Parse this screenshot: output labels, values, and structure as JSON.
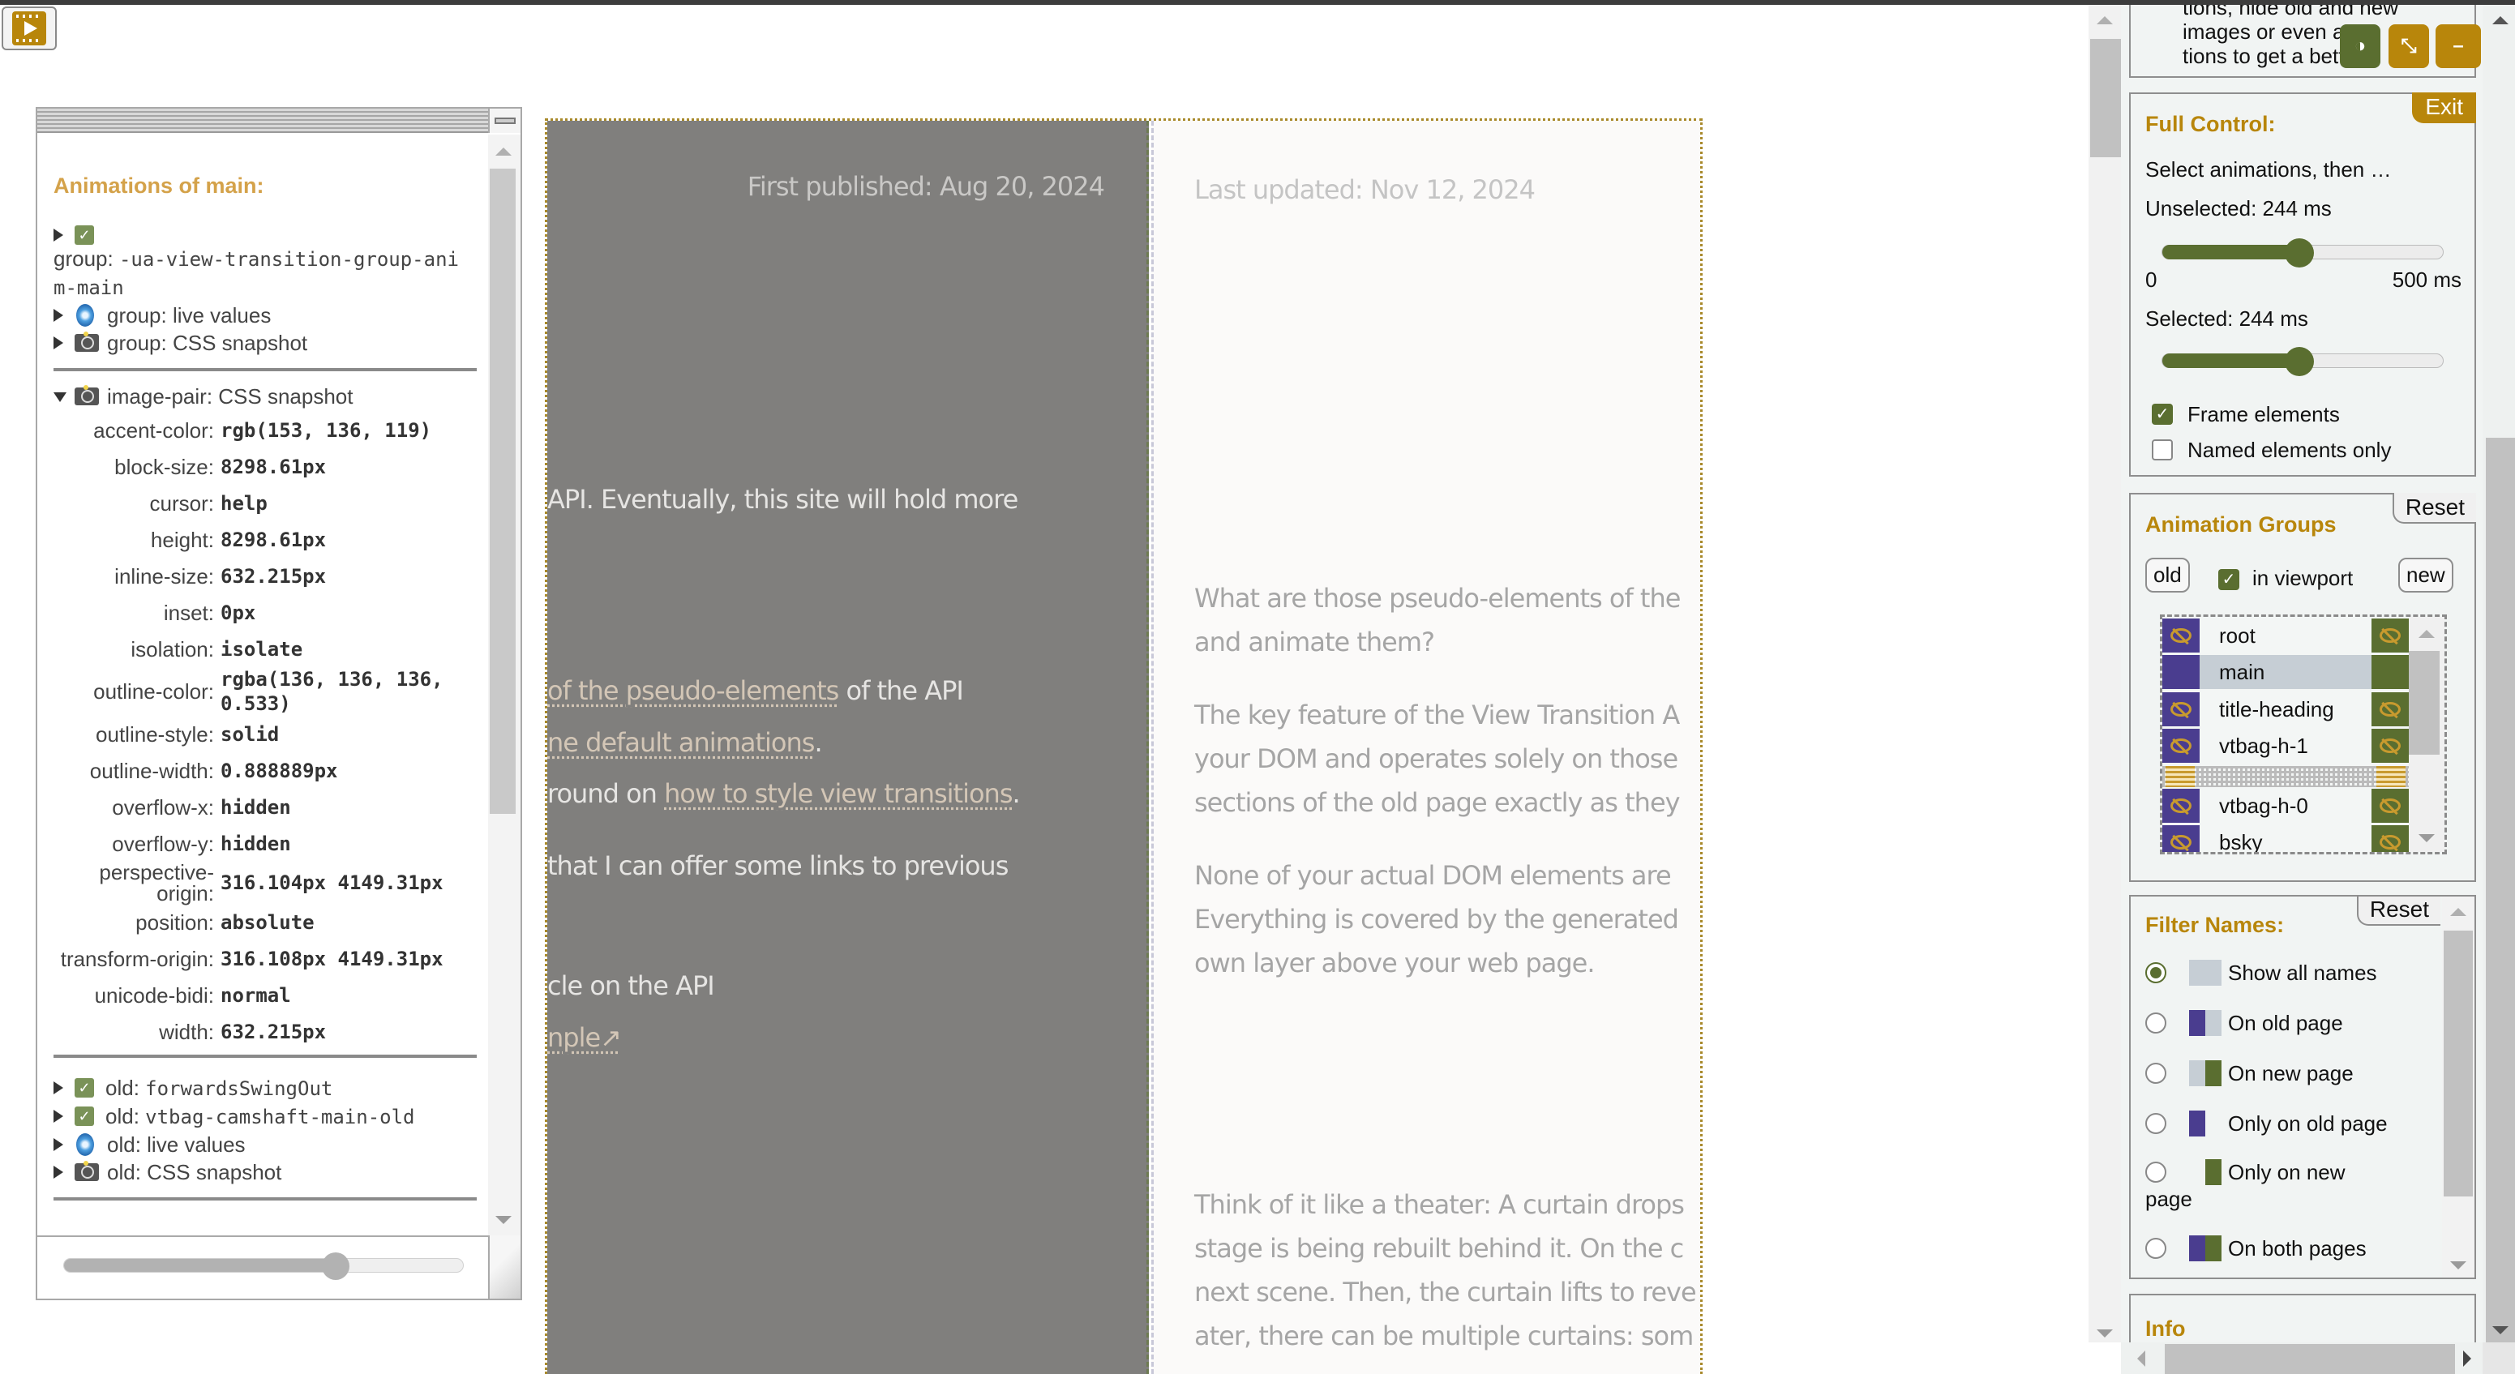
{
  "launcher": {
    "icon": "film-play-icon"
  },
  "inspector": {
    "heading": "Animations of main:",
    "group_items": [
      {
        "icon": "checked",
        "prefix": "group: ",
        "value": "-ua-view-transition-group-anim-main"
      },
      {
        "icon": "live",
        "label": "group: live values"
      },
      {
        "icon": "camera",
        "label": "group: CSS snapshot"
      }
    ],
    "image_pair": {
      "label": "image-pair: CSS snapshot",
      "properties": [
        {
          "key": "accent-color:",
          "value": "rgb(153, 136, 119)"
        },
        {
          "key": "block-size:",
          "value": "8298.61px"
        },
        {
          "key": "cursor:",
          "value": "help"
        },
        {
          "key": "height:",
          "value": "8298.61px"
        },
        {
          "key": "inline-size:",
          "value": "632.215px"
        },
        {
          "key": "inset:",
          "value": "0px"
        },
        {
          "key": "isolation:",
          "value": "isolate"
        },
        {
          "key": "outline-color:",
          "value": "rgba(136, 136, 136, 0.533)"
        },
        {
          "key": "outline-style:",
          "value": "solid"
        },
        {
          "key": "outline-width:",
          "value": "0.888889px"
        },
        {
          "key": "overflow-x:",
          "value": "hidden"
        },
        {
          "key": "overflow-y:",
          "value": "hidden"
        },
        {
          "key": "perspective-origin:",
          "value": "316.104px 4149.31px"
        },
        {
          "key": "position:",
          "value": "absolute"
        },
        {
          "key": "transform-origin:",
          "value": "316.108px 4149.31px"
        },
        {
          "key": "unicode-bidi:",
          "value": "normal"
        },
        {
          "key": "width:",
          "value": "632.215px"
        }
      ]
    },
    "old_items": [
      {
        "icon": "checked",
        "prefix": "old: ",
        "value": "forwardsSwingOut"
      },
      {
        "icon": "checked",
        "prefix": "old: ",
        "value": "vtbag-camshaft-main-old"
      },
      {
        "icon": "live",
        "label": "old: live values"
      },
      {
        "icon": "camera",
        "label": "old: CSS snapshot"
      }
    ],
    "slider_fraction": 0.68
  },
  "old_page": {
    "date": "First published: Aug 20, 2024",
    "line1": "API. Eventually, this site will hold more",
    "line2_link": " of the pseudo-elements",
    "line2_rest": " of the API",
    "line3_link": "ne default animations",
    "line3_rest": ".",
    "line4_pre": "round on ",
    "line4_link": "how to style view transitions",
    "line4_rest": ".",
    "line5": " that I can offer some links to previous",
    "line6": "cle on the API",
    "line7_link": "nple↗"
  },
  "new_page": {
    "date": "Last updated: Nov 12, 2024",
    "paragraphs": [
      [
        "What are those pseudo-elements of the",
        "and animate them?"
      ],
      [
        "The key feature of the View Transition A",
        "your DOM and operates solely on those",
        "sections of the old page exactly as they"
      ],
      [
        "None of your actual DOM elements are",
        "Everything is covered by the generated",
        "own layer above your web page."
      ],
      [
        "Think of it like a theater: A curtain drops",
        "stage is being rebuilt behind it. On the c",
        "next scene. Then, the curtain lifts to reve",
        "ater, there can be multiple curtains: som"
      ]
    ]
  },
  "panel": {
    "intro_lines": [
      "tions, hide old and new",
      "images or even a    a-",
      "tions to get a bett"
    ],
    "header_buttons": [
      {
        "name": "contrast-icon",
        "glyph": "◑",
        "color": "#5a6e30"
      },
      {
        "name": "dock-icon",
        "glyph": "⤡",
        "color": "#b8860b"
      },
      {
        "name": "minimize-icon",
        "glyph": "–",
        "color": "#b8860b"
      }
    ],
    "full_control": {
      "title": "Full Control:",
      "exit_label": "Exit",
      "hint": "Select animations, then …",
      "unselected_label": "Unselected: 244 ms",
      "unselected_value_ms": 244,
      "min_label": "0",
      "max_label": "500 ms",
      "range_ms": [
        0,
        500
      ],
      "selected_label": "Selected: 244 ms",
      "selected_value_ms": 244,
      "frame_elements_label": "Frame elements",
      "frame_elements_checked": true,
      "named_only_label": "Named elements only",
      "named_only_checked": false
    },
    "animation_groups": {
      "title": "Animation Groups",
      "reset_label": "Reset",
      "old_label": "old",
      "new_label": "new",
      "in_viewport_label": "in viewport",
      "in_viewport_checked": true,
      "items": [
        {
          "name": "root",
          "selected": false,
          "hidden_icons": true
        },
        {
          "name": "main",
          "selected": true,
          "hidden_icons": false
        },
        {
          "name": "title-heading",
          "selected": false,
          "hidden_icons": true
        },
        {
          "name": "vtbag-h-1",
          "selected": false,
          "hidden_icons": true
        },
        {
          "name": "vtbag-h-0",
          "selected": false,
          "hidden_icons": true
        },
        {
          "name": "bsky",
          "selected": false,
          "hidden_icons": true
        }
      ]
    },
    "filter_names": {
      "title": "Filter Names:",
      "reset_label": "Reset",
      "options": [
        {
          "label": "Show all names",
          "checked": true,
          "swatch": [
            "#c6ced5",
            "#c6ced5"
          ]
        },
        {
          "label": "On old page",
          "checked": false,
          "swatch": [
            "#4a3d8f",
            "#c6ced5"
          ]
        },
        {
          "label": "On new page",
          "checked": false,
          "swatch": [
            "#c6ced5",
            "#5a6e30"
          ]
        },
        {
          "label": "Only on old page",
          "checked": false,
          "swatch": [
            "#4a3d8f",
            "transparent"
          ]
        },
        {
          "label": "Only on new",
          "label2": "page",
          "checked": false,
          "swatch": [
            "transparent",
            "#5a6e30"
          ]
        },
        {
          "label": "On both pages",
          "checked": false,
          "swatch": [
            "#4a3d8f",
            "#5a6e30"
          ]
        }
      ]
    },
    "info": {
      "title": "Info"
    }
  },
  "colors": {
    "accent_gold": "#b8860b",
    "old_purple": "#4a3d8f",
    "new_green": "#5a6e30"
  }
}
